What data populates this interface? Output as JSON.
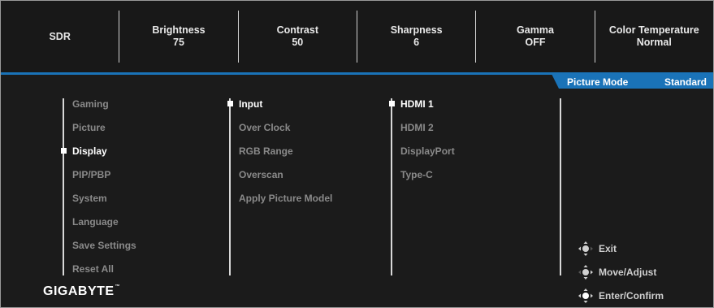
{
  "status_bar": [
    {
      "label": "SDR",
      "value": ""
    },
    {
      "label": "Brightness",
      "value": "75"
    },
    {
      "label": "Contrast",
      "value": "50"
    },
    {
      "label": "Sharpness",
      "value": "6"
    },
    {
      "label": "Gamma",
      "value": "OFF"
    },
    {
      "label": "Color Temperature",
      "value": "Normal"
    }
  ],
  "mode": {
    "label": "Picture Mode",
    "value": "Standard"
  },
  "main_menu": {
    "items": [
      "Gaming",
      "Picture",
      "Display",
      "PIP/PBP",
      "System",
      "Language",
      "Save Settings",
      "Reset All"
    ],
    "selected": "Display"
  },
  "sub_menu": {
    "items": [
      "Input",
      "Over Clock",
      "RGB Range",
      "Overscan",
      "Apply Picture Model"
    ],
    "selected": "Input"
  },
  "options": {
    "items": [
      "HDMI 1",
      "HDMI 2",
      "DisplayPort",
      "Type-C"
    ],
    "selected": "HDMI 1"
  },
  "hints": [
    {
      "icon": "joystick-left-icon",
      "label": "Exit"
    },
    {
      "icon": "joystick-move-icon",
      "label": "Move/Adjust"
    },
    {
      "icon": "joystick-press-icon",
      "label": "Enter/Confirm"
    }
  ],
  "brand": {
    "name": "GIGABYTE",
    "mark": "™"
  },
  "colors": {
    "accent": "#1a73b8",
    "background": "#1b1b1b",
    "inactive_text": "#8a8a8a"
  }
}
